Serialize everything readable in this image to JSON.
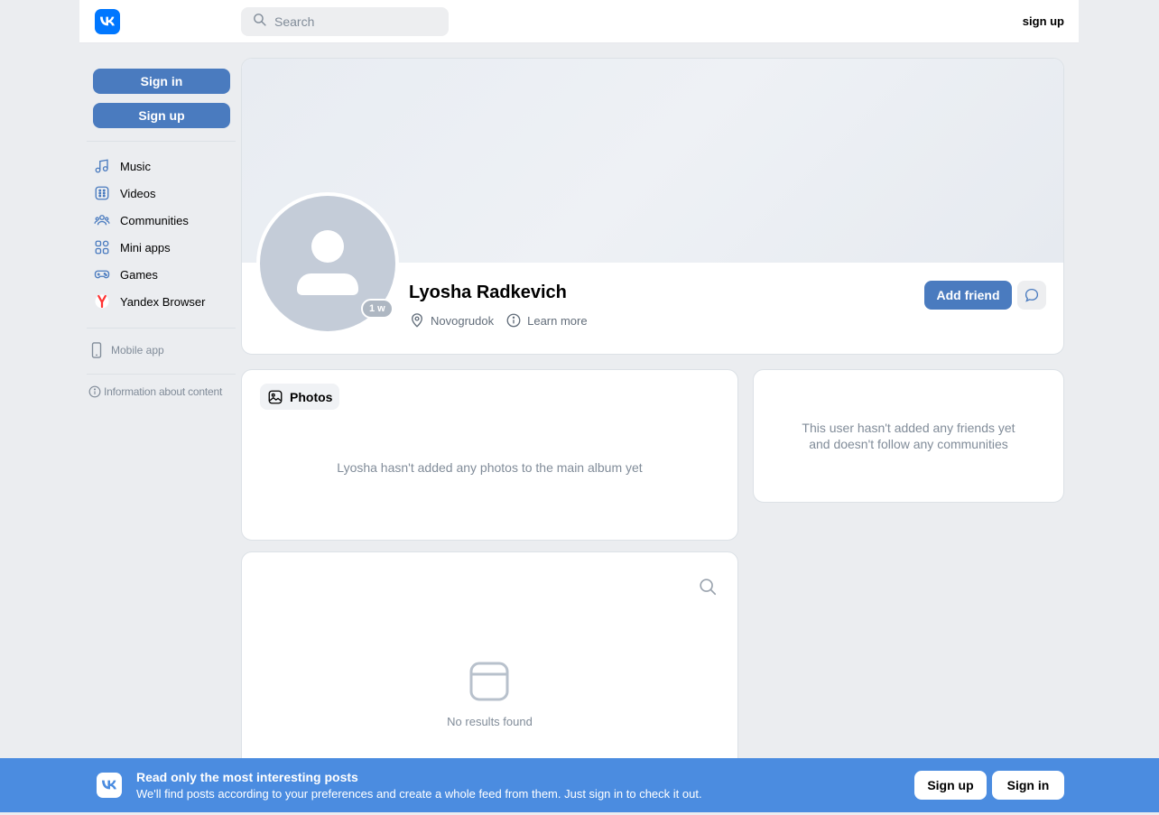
{
  "header": {
    "logo_icon": "vk-logo-icon",
    "search_placeholder": "Search",
    "signup_link": "sign up"
  },
  "sidebar": {
    "sign_in": "Sign in",
    "sign_up": "Sign up",
    "items": [
      {
        "label": "Music",
        "icon": "music-note-icon"
      },
      {
        "label": "Videos",
        "icon": "video-icon"
      },
      {
        "label": "Communities",
        "icon": "communities-icon"
      },
      {
        "label": "Mini apps",
        "icon": "mini-apps-icon"
      },
      {
        "label": "Games",
        "icon": "gamepad-icon"
      },
      {
        "label": "Yandex Browser",
        "icon": "yandex-browser-icon"
      }
    ],
    "mobile_app": "Mobile app",
    "info": "Information about content"
  },
  "profile": {
    "name": "Lyosha Radkevich",
    "online_badge": "1 w",
    "location": "Novogrudok",
    "learn_more": "Learn more",
    "add_friend": "Add friend"
  },
  "photos": {
    "tab_label": "Photos",
    "empty_text": "Lyosha hasn't added any photos to the main album yet"
  },
  "friends": {
    "line1": "This user hasn't added any friends yet",
    "line2": "and doesn't follow any communities"
  },
  "wall": {
    "no_results": "No results found"
  },
  "banner": {
    "title": "Read only the most interesting posts",
    "subtitle": "We'll find posts according to your preferences and create a whole feed from them. Just sign in to check it out.",
    "sign_up": "Sign up",
    "sign_in": "Sign in"
  },
  "colors": {
    "accent": "#4a7bbf",
    "brand": "#0077ff",
    "banner": "#4b8ce0",
    "background": "#ebedf0"
  }
}
